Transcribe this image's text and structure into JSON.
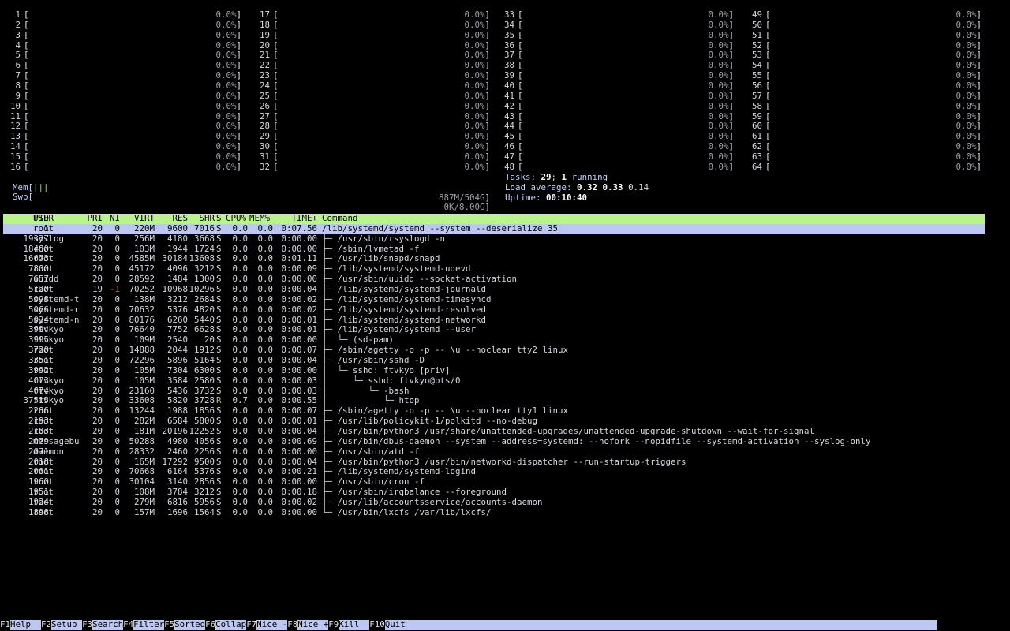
{
  "cpus": [
    {
      "n": "1",
      "pct": "0.0%"
    },
    {
      "n": "2",
      "pct": "0.0%"
    },
    {
      "n": "3",
      "pct": "0.0%"
    },
    {
      "n": "4",
      "pct": "0.0%"
    },
    {
      "n": "5",
      "pct": "0.0%"
    },
    {
      "n": "6",
      "pct": "0.0%"
    },
    {
      "n": "7",
      "pct": "0.0%"
    },
    {
      "n": "8",
      "pct": "0.0%"
    },
    {
      "n": "9",
      "pct": "0.0%"
    },
    {
      "n": "10",
      "pct": "0.0%"
    },
    {
      "n": "11",
      "pct": "0.0%"
    },
    {
      "n": "12",
      "pct": "0.0%"
    },
    {
      "n": "13",
      "pct": "0.0%"
    },
    {
      "n": "14",
      "pct": "0.0%"
    },
    {
      "n": "15",
      "pct": "0.0%"
    },
    {
      "n": "16",
      "pct": "0.0%"
    },
    {
      "n": "17",
      "pct": "0.0%"
    },
    {
      "n": "18",
      "pct": "0.0%"
    },
    {
      "n": "19",
      "pct": "0.0%"
    },
    {
      "n": "20",
      "pct": "0.0%"
    },
    {
      "n": "21",
      "pct": "0.0%"
    },
    {
      "n": "22",
      "pct": "0.0%"
    },
    {
      "n": "23",
      "pct": "0.0%"
    },
    {
      "n": "24",
      "pct": "0.0%"
    },
    {
      "n": "25",
      "pct": "0.0%"
    },
    {
      "n": "26",
      "pct": "0.0%"
    },
    {
      "n": "27",
      "pct": "0.0%"
    },
    {
      "n": "28",
      "pct": "0.0%"
    },
    {
      "n": "29",
      "pct": "0.0%"
    },
    {
      "n": "30",
      "pct": "0.0%"
    },
    {
      "n": "31",
      "pct": "0.0%"
    },
    {
      "n": "32",
      "pct": "0.0%"
    },
    {
      "n": "33",
      "pct": "0.0%"
    },
    {
      "n": "34",
      "pct": "0.0%"
    },
    {
      "n": "35",
      "pct": "0.0%"
    },
    {
      "n": "36",
      "pct": "0.0%"
    },
    {
      "n": "37",
      "pct": "0.0%"
    },
    {
      "n": "38",
      "pct": "0.0%"
    },
    {
      "n": "39",
      "pct": "0.0%"
    },
    {
      "n": "40",
      "pct": "0.0%"
    },
    {
      "n": "41",
      "pct": "0.0%"
    },
    {
      "n": "42",
      "pct": "0.0%"
    },
    {
      "n": "43",
      "pct": "0.0%"
    },
    {
      "n": "44",
      "pct": "0.0%"
    },
    {
      "n": "45",
      "pct": "0.0%"
    },
    {
      "n": "46",
      "pct": "0.0%"
    },
    {
      "n": "47",
      "pct": "0.0%"
    },
    {
      "n": "48",
      "pct": "0.0%"
    },
    {
      "n": "49",
      "pct": "0.0%"
    },
    {
      "n": "50",
      "pct": "0.0%"
    },
    {
      "n": "51",
      "pct": "0.0%"
    },
    {
      "n": "52",
      "pct": "0.0%"
    },
    {
      "n": "53",
      "pct": "0.0%"
    },
    {
      "n": "54",
      "pct": "0.0%"
    },
    {
      "n": "55",
      "pct": "0.0%"
    },
    {
      "n": "56",
      "pct": "0.0%"
    },
    {
      "n": "57",
      "pct": "0.0%"
    },
    {
      "n": "58",
      "pct": "0.0%"
    },
    {
      "n": "59",
      "pct": "0.0%"
    },
    {
      "n": "60",
      "pct": "0.0%"
    },
    {
      "n": "61",
      "pct": "0.0%"
    },
    {
      "n": "62",
      "pct": "0.0%"
    },
    {
      "n": "63",
      "pct": "0.0%"
    },
    {
      "n": "64",
      "pct": "0.0%"
    }
  ],
  "mem": {
    "label": "Mem",
    "bar": "|||",
    "value": "887M/504G"
  },
  "swp": {
    "label": "Swp",
    "bar": "",
    "value": "0K/8.00G"
  },
  "info": {
    "tasks_label": "Tasks: ",
    "tasks": "29",
    "tasks_sep": "; ",
    "running": "1",
    "running_label": " running",
    "load_label": "Load average: ",
    "load1": "0.32",
    "load5": "0.33",
    "load15": "0.14",
    "uptime_label": "Uptime: ",
    "uptime": "00:10:40"
  },
  "header": {
    "pid": "PID",
    "user": "USER",
    "pri": "PRI",
    "ni": "NI",
    "virt": "VIRT",
    "res": "RES",
    "shr": "SHR",
    "s": "S",
    "cpu": "CPU%",
    "mem": "MEM%",
    "time": "TIME+",
    "cmd": "Command"
  },
  "processes": [
    {
      "pid": "1",
      "user": "root",
      "pri": "20",
      "ni": "0",
      "virt": "220M",
      "res": "9600",
      "shr": "7016",
      "s": "S",
      "cpu": "0.0",
      "mem": "0.0",
      "time": "0:07.56",
      "tree": "",
      "cmd": "/lib/systemd/systemd --system --deserialize 35"
    },
    {
      "pid": "19337",
      "user": "syslog",
      "pri": "20",
      "ni": "0",
      "virt": "256M",
      "res": "4180",
      "shr": "3668",
      "s": "S",
      "cpu": "0.0",
      "mem": "0.0",
      "time": "0:00.00",
      "tree": "├─ ",
      "cmd": "/usr/sbin/rsyslogd -n"
    },
    {
      "pid": "18480",
      "user": "root",
      "pri": "20",
      "ni": "0",
      "virt": "103M",
      "res": "1944",
      "shr": "1724",
      "s": "S",
      "cpu": "0.0",
      "mem": "0.0",
      "time": "0:00.00",
      "tree": "├─ ",
      "cmd": "/sbin/lvmetad -f"
    },
    {
      "pid": "16673",
      "user": "root",
      "pri": "20",
      "ni": "0",
      "virt": "4585M",
      "res": "30184",
      "shr": "13608",
      "s": "S",
      "cpu": "0.0",
      "mem": "0.0",
      "time": "0:01.11",
      "tree": "├─ ",
      "cmd": "/usr/lib/snapd/snapd"
    },
    {
      "pid": "7800",
      "user": "root",
      "pri": "20",
      "ni": "0",
      "virt": "45172",
      "res": "4096",
      "shr": "3212",
      "s": "S",
      "cpu": "0.0",
      "mem": "0.0",
      "time": "0:00.09",
      "tree": "├─ ",
      "cmd": "/lib/systemd/systemd-udevd"
    },
    {
      "pid": "7657",
      "user": "uuidd",
      "pri": "20",
      "ni": "0",
      "virt": "28592",
      "res": "1484",
      "shr": "1300",
      "s": "S",
      "cpu": "0.0",
      "mem": "0.0",
      "time": "0:00.00",
      "tree": "├─ ",
      "cmd": "/usr/sbin/uuidd --socket-activation"
    },
    {
      "pid": "5120",
      "user": "root",
      "pri": "19",
      "ni": "-1",
      "virt": "70252",
      "res": "10968",
      "shr": "10296",
      "s": "S",
      "cpu": "0.0",
      "mem": "0.0",
      "time": "0:00.04",
      "tree": "├─ ",
      "cmd": "/lib/systemd/systemd-journald"
    },
    {
      "pid": "5098",
      "user": "systemd-t",
      "pri": "20",
      "ni": "0",
      "virt": "138M",
      "res": "3212",
      "shr": "2684",
      "s": "S",
      "cpu": "0.0",
      "mem": "0.0",
      "time": "0:00.02",
      "tree": "├─ ",
      "cmd": "/lib/systemd/systemd-timesyncd"
    },
    {
      "pid": "5066",
      "user": "systemd-r",
      "pri": "20",
      "ni": "0",
      "virt": "70632",
      "res": "5376",
      "shr": "4820",
      "s": "S",
      "cpu": "0.0",
      "mem": "0.0",
      "time": "0:00.02",
      "tree": "├─ ",
      "cmd": "/lib/systemd/systemd-resolved"
    },
    {
      "pid": "5034",
      "user": "systemd-n",
      "pri": "20",
      "ni": "0",
      "virt": "80176",
      "res": "6260",
      "shr": "5440",
      "s": "S",
      "cpu": "0.0",
      "mem": "0.0",
      "time": "0:00.01",
      "tree": "├─ ",
      "cmd": "/lib/systemd/systemd-networkd"
    },
    {
      "pid": "3994",
      "user": "ftvkyo",
      "pri": "20",
      "ni": "0",
      "virt": "76640",
      "res": "7752",
      "shr": "6628",
      "s": "S",
      "cpu": "0.0",
      "mem": "0.0",
      "time": "0:00.01",
      "tree": "├─ ",
      "cmd": "/lib/systemd/systemd --user"
    },
    {
      "pid": "3995",
      "user": "ftvkyo",
      "pri": "20",
      "ni": "0",
      "virt": "109M",
      "res": "2540",
      "shr": "20",
      "s": "S",
      "cpu": "0.0",
      "mem": "0.0",
      "time": "0:00.00",
      "tree": "│  └─ ",
      "cmd": "(sd-pam)"
    },
    {
      "pid": "3720",
      "user": "root",
      "pri": "20",
      "ni": "0",
      "virt": "14888",
      "res": "2044",
      "shr": "1912",
      "s": "S",
      "cpu": "0.0",
      "mem": "0.0",
      "time": "0:00.07",
      "tree": "├─ ",
      "cmd": "/sbin/agetty -o -p -- \\u --noclear tty2 linux"
    },
    {
      "pid": "3351",
      "user": "root",
      "pri": "20",
      "ni": "0",
      "virt": "72296",
      "res": "5896",
      "shr": "5164",
      "s": "S",
      "cpu": "0.0",
      "mem": "0.0",
      "time": "0:00.04",
      "tree": "├─ ",
      "cmd": "/usr/sbin/sshd -D"
    },
    {
      "pid": "3992",
      "user": "root",
      "pri": "20",
      "ni": "0",
      "virt": "105M",
      "res": "7304",
      "shr": "6300",
      "s": "S",
      "cpu": "0.0",
      "mem": "0.0",
      "time": "0:00.00",
      "tree": "│  └─ ",
      "cmd": "sshd: ftvkyo [priv]"
    },
    {
      "pid": "4073",
      "user": "ftvkyo",
      "pri": "20",
      "ni": "0",
      "virt": "105M",
      "res": "3584",
      "shr": "2580",
      "s": "S",
      "cpu": "0.0",
      "mem": "0.0",
      "time": "0:00.03",
      "tree": "│     └─ ",
      "cmd": "sshd: ftvkyo@pts/0"
    },
    {
      "pid": "4074",
      "user": "ftvkyo",
      "pri": "20",
      "ni": "0",
      "virt": "23160",
      "res": "5436",
      "shr": "3732",
      "s": "S",
      "cpu": "0.0",
      "mem": "0.0",
      "time": "0:00.03",
      "tree": "│        └─ ",
      "cmd": "-bash"
    },
    {
      "pid": "37515",
      "user": "ftvkyo",
      "pri": "20",
      "ni": "0",
      "virt": "33608",
      "res": "5820",
      "shr": "3728",
      "s": "R",
      "cpu": "0.7",
      "mem": "0.0",
      "time": "0:00.55",
      "tree": "│           └─ ",
      "cmd": "htop"
    },
    {
      "pid": "2286",
      "user": "root",
      "pri": "20",
      "ni": "0",
      "virt": "13244",
      "res": "1988",
      "shr": "1856",
      "s": "S",
      "cpu": "0.0",
      "mem": "0.0",
      "time": "0:00.07",
      "tree": "├─ ",
      "cmd": "/sbin/agetty -o -p -- \\u --noclear tty1 linux"
    },
    {
      "pid": "2193",
      "user": "root",
      "pri": "20",
      "ni": "0",
      "virt": "282M",
      "res": "6584",
      "shr": "5800",
      "s": "S",
      "cpu": "0.0",
      "mem": "0.0",
      "time": "0:00.01",
      "tree": "├─ ",
      "cmd": "/usr/lib/policykit-1/polkitd --no-debug"
    },
    {
      "pid": "2103",
      "user": "root",
      "pri": "20",
      "ni": "0",
      "virt": "181M",
      "res": "20196",
      "shr": "12252",
      "s": "S",
      "cpu": "0.0",
      "mem": "0.0",
      "time": "0:00.04",
      "tree": "├─ ",
      "cmd": "/usr/bin/python3 /usr/share/unattended-upgrades/unattended-upgrade-shutdown --wait-for-signal"
    },
    {
      "pid": "2079",
      "user": "messagebu",
      "pri": "20",
      "ni": "0",
      "virt": "50288",
      "res": "4980",
      "shr": "4056",
      "s": "S",
      "cpu": "0.0",
      "mem": "0.0",
      "time": "0:00.69",
      "tree": "├─ ",
      "cmd": "/usr/bin/dbus-daemon --system --address=systemd: --nofork --nopidfile --systemd-activation --syslog-only"
    },
    {
      "pid": "2071",
      "user": "daemon",
      "pri": "20",
      "ni": "0",
      "virt": "28332",
      "res": "2460",
      "shr": "2256",
      "s": "S",
      "cpu": "0.0",
      "mem": "0.0",
      "time": "0:00.00",
      "tree": "├─ ",
      "cmd": "/usr/sbin/atd -f"
    },
    {
      "pid": "2018",
      "user": "root",
      "pri": "20",
      "ni": "0",
      "virt": "165M",
      "res": "17292",
      "shr": "9500",
      "s": "S",
      "cpu": "0.0",
      "mem": "0.0",
      "time": "0:00.04",
      "tree": "├─ ",
      "cmd": "/usr/bin/python3 /usr/bin/networkd-dispatcher --run-startup-triggers"
    },
    {
      "pid": "2001",
      "user": "root",
      "pri": "20",
      "ni": "0",
      "virt": "70668",
      "res": "6164",
      "shr": "5376",
      "s": "S",
      "cpu": "0.0",
      "mem": "0.0",
      "time": "0:00.21",
      "tree": "├─ ",
      "cmd": "/lib/systemd/systemd-logind"
    },
    {
      "pid": "1960",
      "user": "root",
      "pri": "20",
      "ni": "0",
      "virt": "30104",
      "res": "3140",
      "shr": "2856",
      "s": "S",
      "cpu": "0.0",
      "mem": "0.0",
      "time": "0:00.00",
      "tree": "├─ ",
      "cmd": "/usr/sbin/cron -f"
    },
    {
      "pid": "1951",
      "user": "root",
      "pri": "20",
      "ni": "0",
      "virt": "108M",
      "res": "3784",
      "shr": "3212",
      "s": "S",
      "cpu": "0.0",
      "mem": "0.0",
      "time": "0:00.18",
      "tree": "├─ ",
      "cmd": "/usr/sbin/irqbalance --foreground"
    },
    {
      "pid": "1924",
      "user": "root",
      "pri": "20",
      "ni": "0",
      "virt": "279M",
      "res": "6816",
      "shr": "5956",
      "s": "S",
      "cpu": "0.0",
      "mem": "0.0",
      "time": "0:00.02",
      "tree": "├─ ",
      "cmd": "/usr/lib/accountsservice/accounts-daemon"
    },
    {
      "pid": "1898",
      "user": "root",
      "pri": "20",
      "ni": "0",
      "virt": "157M",
      "res": "1696",
      "shr": "1564",
      "s": "S",
      "cpu": "0.0",
      "mem": "0.0",
      "time": "0:00.00",
      "tree": "└─ ",
      "cmd": "/usr/bin/lxcfs /var/lib/lxcfs/"
    }
  ],
  "footer": [
    {
      "key": "F1",
      "label": "Help  "
    },
    {
      "key": "F2",
      "label": "Setup "
    },
    {
      "key": "F3",
      "label": "Search"
    },
    {
      "key": "F4",
      "label": "Filter"
    },
    {
      "key": "F5",
      "label": "Sorted"
    },
    {
      "key": "F6",
      "label": "Collap"
    },
    {
      "key": "F7",
      "label": "Nice -"
    },
    {
      "key": "F8",
      "label": "Nice +"
    },
    {
      "key": "F9",
      "label": "Kill  "
    },
    {
      "key": "F10",
      "label": "Quit"
    }
  ],
  "colors": {
    "header_bg": "#b9f48a",
    "selected_bg": "#bcc8f2",
    "footer_label_bg": "#bcc8f2",
    "mem_bar": "#a0d070",
    "negative_nice": "#ff5050"
  }
}
